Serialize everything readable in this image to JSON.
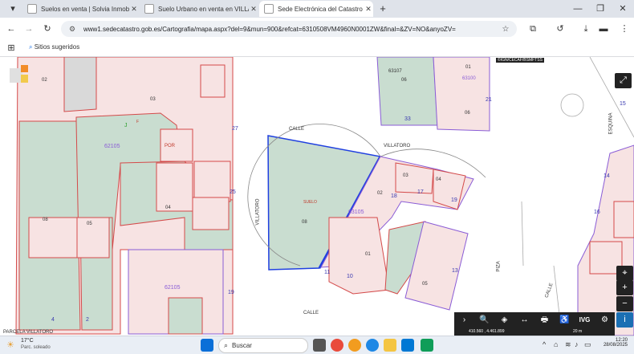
{
  "tabs": [
    {
      "label": "Suelos en venta | Solvia Inmobiliaria",
      "favicon": "#1a73e8"
    },
    {
      "label": "Suelo Urbano en venta en VILLATORO",
      "favicon": "#4285f4"
    },
    {
      "label": "Sede Electrónica del Catastro - Fin",
      "favicon": "#c0392b"
    }
  ],
  "new_tab": "+",
  "window_controls": {
    "minimize": "—",
    "maximize": "❐",
    "close": "✕"
  },
  "toolbar": {
    "url": "www1.sedecatastro.gob.es/Cartografia/mapa.aspx?del=9&mun=900&refcat=6310508VM4960N0001ZW&final=&ZV=NO&anyoZV="
  },
  "bookmarks": {
    "suggested": "Sitios sugeridos"
  },
  "map": {
    "header_text": "©IGN/CECAF/BSMFTSS",
    "streets": [
      "CALLE",
      "VILLATORO",
      "VILLATORO",
      "ESQUINA",
      "PIZA",
      "CALLE",
      "CALLE",
      "PARCELA VILLATORO"
    ],
    "blocks": [
      "62105",
      "63105",
      "62105",
      "63100",
      "63107"
    ],
    "parcel_labels": [
      "03",
      "04",
      "05",
      "06",
      "08",
      "01",
      "02",
      "03",
      "04",
      "05",
      "06",
      "08",
      "01",
      "02",
      "J",
      "F",
      "POR",
      "SUELO"
    ],
    "edge_numbers": [
      "27",
      "25",
      "13",
      "18",
      "17",
      "19",
      "16",
      "14",
      "11",
      "10",
      "19",
      "21",
      "33",
      "4",
      "2",
      "15"
    ],
    "scale_text": "20 m",
    "coords_text": "410.560 , 4.461.899"
  },
  "map_tools": [
    "›",
    "🔍",
    "◈",
    "↔",
    "🖶",
    "♿",
    "IVG",
    "⚙"
  ],
  "weather": {
    "temp": "17°C",
    "desc": "Parc. soleado"
  },
  "search": {
    "placeholder": "Buscar"
  },
  "clock": {
    "time": "12:20",
    "date": "28/08/2025"
  },
  "colors": {
    "parcel_green": "#c9ddd0",
    "parcel_pink": "#f4dcdc",
    "boundary_red": "#d44a4a",
    "boundary_purple": "#8a5cd6",
    "selected_blue": "#1f3fe0"
  }
}
